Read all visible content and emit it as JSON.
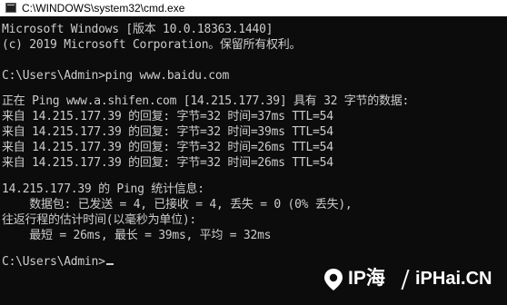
{
  "window": {
    "title": "C:\\WINDOWS\\system32\\cmd.exe",
    "icon": "cmd-icon"
  },
  "console": {
    "lines": [
      "Microsoft Windows [版本 10.0.18363.1440]",
      "(c) 2019 Microsoft Corporation。保留所有权利。",
      "",
      "C:\\Users\\Admin>ping www.baidu.com",
      "",
      "正在 Ping www.a.shifen.com [14.215.177.39] 具有 32 字节的数据:",
      "来自 14.215.177.39 的回复: 字节=32 时间=37ms TTL=54",
      "来自 14.215.177.39 的回复: 字节=32 时间=39ms TTL=54",
      "来自 14.215.177.39 的回复: 字节=32 时间=26ms TTL=54",
      "来自 14.215.177.39 的回复: 字节=32 时间=26ms TTL=54",
      "",
      "14.215.177.39 的 Ping 统计信息:",
      "    数据包: 已发送 = 4, 已接收 = 4, 丢失 = 0 (0% 丢失),",
      "往返行程的估计时间(以毫秒为单位):",
      "    最短 = 26ms, 最长 = 39ms, 平均 = 32ms",
      "",
      "C:\\Users\\Admin>"
    ]
  },
  "watermark": {
    "brand": "IP海",
    "site": "iPHai.CN"
  },
  "colors": {
    "console_bg": "#0c0c0c",
    "console_fg": "#cccccc",
    "titlebar_bg": "#ffffff"
  }
}
